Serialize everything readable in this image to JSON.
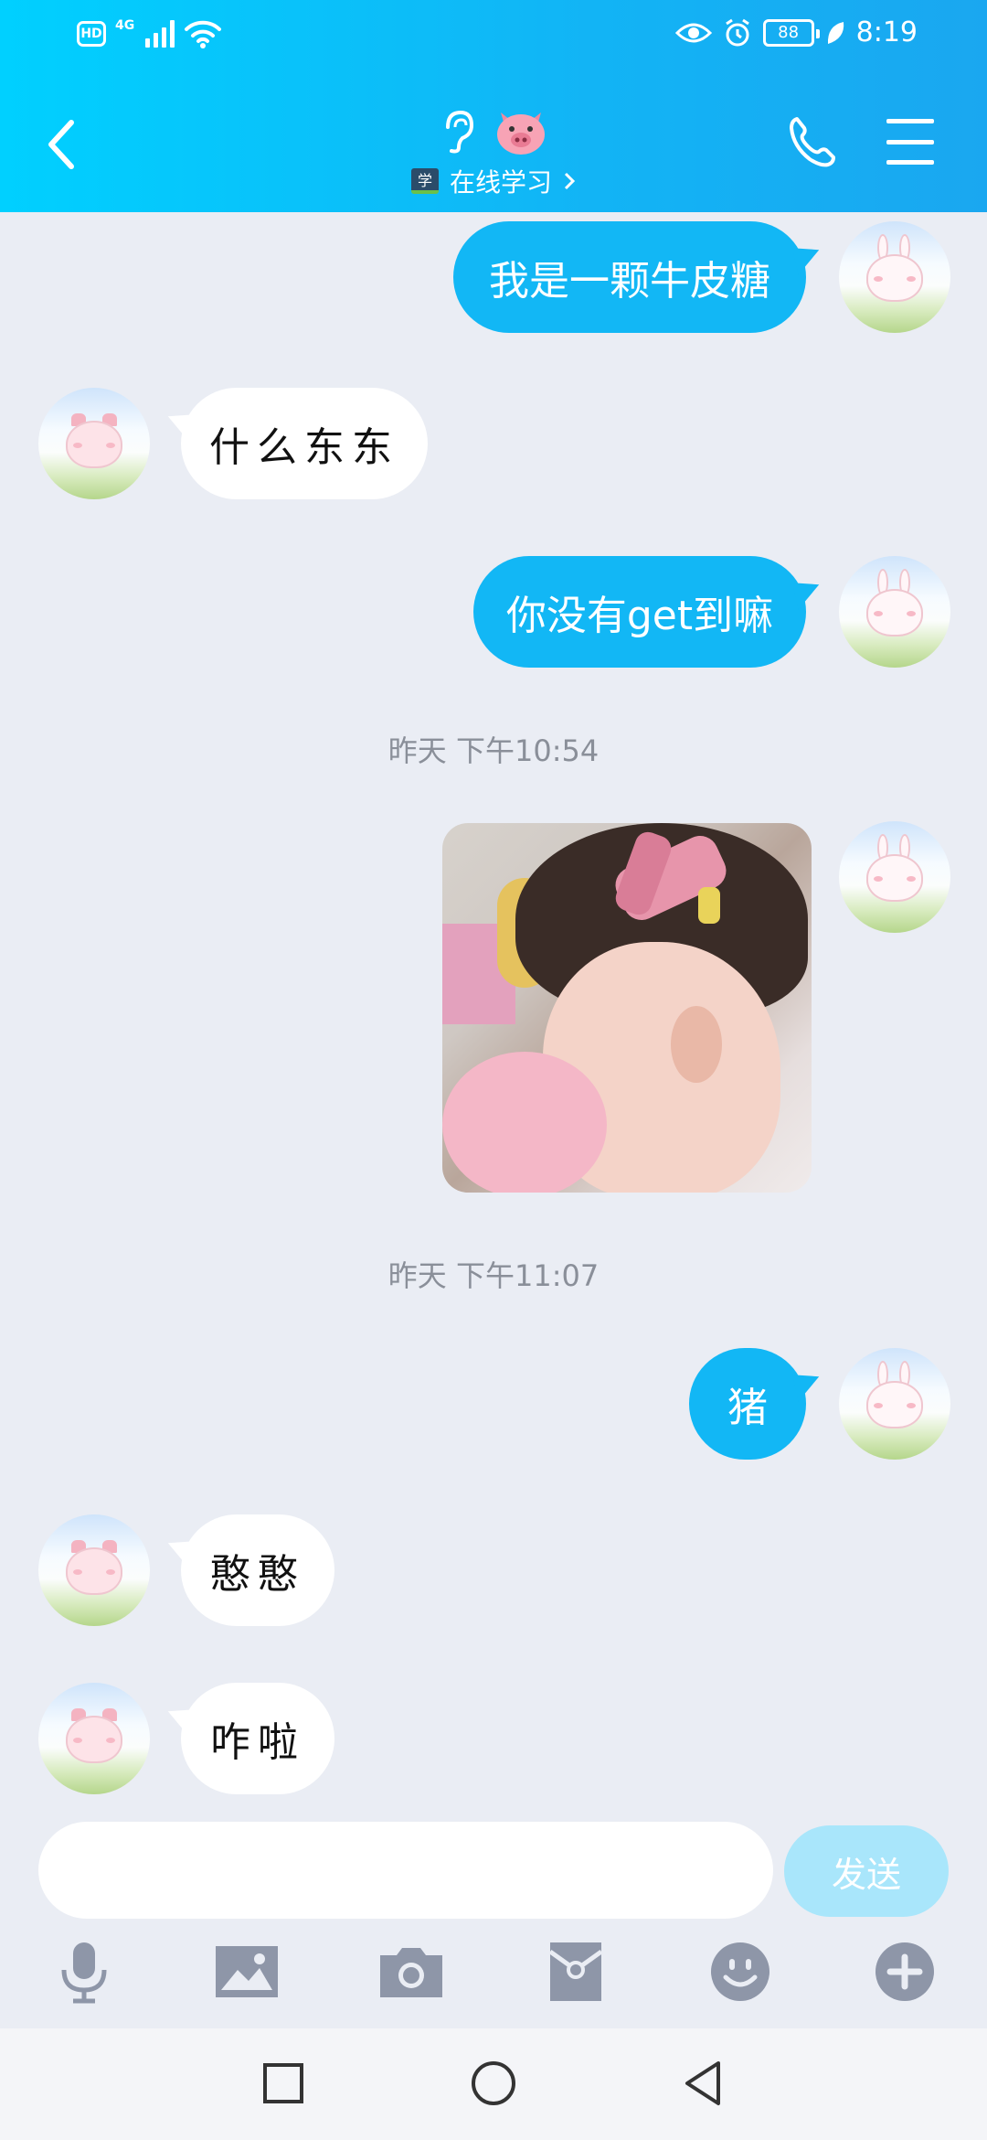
{
  "status_bar": {
    "hd": "HD",
    "network": "4G",
    "battery": "88",
    "time": "8:19"
  },
  "header": {
    "title_icon_1": "ear-icon",
    "title_icon_2": "pig-emoji-icon",
    "status_badge": "学",
    "subtitle": "在线学习",
    "back": "chevron-left-icon",
    "call": "phone-icon",
    "menu": "hamburger-menu-icon"
  },
  "messages": [
    {
      "side": "out",
      "text": "我是一颗牛皮糖"
    },
    {
      "side": "in",
      "text": "什么东东"
    },
    {
      "side": "out",
      "text": "你没有get到嘛"
    },
    {
      "type": "time",
      "text": "昨天 下午10:54"
    },
    {
      "side": "out",
      "type": "image",
      "alt": "photo of a toddler with pink bow drinking from pink cup"
    },
    {
      "type": "time",
      "text": "昨天 下午11:07"
    },
    {
      "side": "out",
      "text": "猪"
    },
    {
      "side": "in",
      "text": "憨憨"
    },
    {
      "side": "in",
      "text": "咋啦"
    }
  ],
  "composer": {
    "input_value": "",
    "send_label": "发送"
  },
  "toolbar": [
    "microphone-icon",
    "image-icon",
    "camera-icon",
    "red-packet-icon",
    "emoji-icon",
    "plus-icon"
  ],
  "navbar": [
    "square-recents-icon",
    "circle-home-icon",
    "triangle-back-icon"
  ],
  "colors": {
    "header_start": "#00d0ff",
    "header_end": "#1aa7f0",
    "bubble_out": "#12b7f5",
    "bubble_in": "#ffffff",
    "chat_bg": "#eaedf4",
    "send_disabled": "#a9e6fb",
    "toolbar_icon": "#8e96a8"
  }
}
